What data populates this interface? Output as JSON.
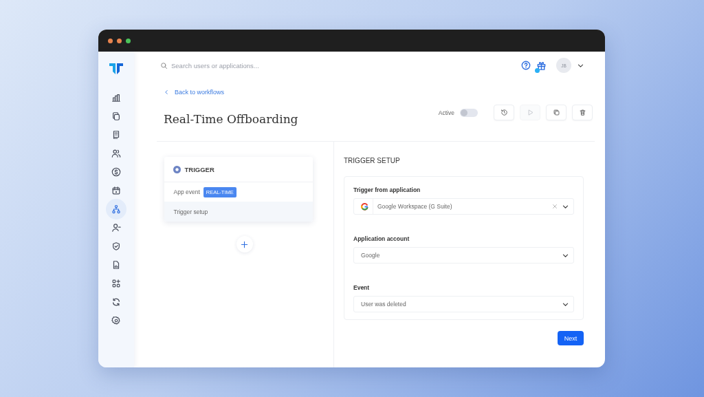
{
  "sidebar": {
    "items": [
      {
        "kind": "chart",
        "selected": false
      },
      {
        "kind": "copy",
        "selected": false
      },
      {
        "kind": "document",
        "selected": false
      },
      {
        "kind": "users",
        "selected": false
      },
      {
        "kind": "dollar",
        "selected": false
      },
      {
        "kind": "calendar",
        "selected": false
      },
      {
        "kind": "workflow",
        "selected": true
      },
      {
        "kind": "user-minus",
        "selected": false
      },
      {
        "kind": "shield",
        "selected": false
      },
      {
        "kind": "report",
        "selected": false
      },
      {
        "kind": "apps",
        "selected": false
      },
      {
        "kind": "sync",
        "selected": false
      },
      {
        "kind": "gear",
        "selected": false
      }
    ]
  },
  "search": {
    "placeholder": "Search users or applications..."
  },
  "header": {
    "avatar": "JB"
  },
  "back_link": "Back to workflows",
  "title": "Real-Time Offboarding",
  "active_toggle": {
    "label": "Active",
    "on": false
  },
  "toolbar": [
    {
      "kind": "history",
      "disabled": false
    },
    {
      "kind": "play",
      "disabled": true
    },
    {
      "kind": "copy",
      "disabled": false
    },
    {
      "kind": "delete",
      "disabled": false
    }
  ],
  "trigger_card": {
    "title": "TRIGGER",
    "rows": [
      {
        "label": "App event",
        "badge": "REAL-TIME",
        "selected": false
      },
      {
        "label": "Trigger setup",
        "selected": true
      }
    ]
  },
  "setup": {
    "title": "TRIGGER SETUP",
    "fields": [
      {
        "label": "Trigger from application",
        "value": "Google Workspace (G Suite)",
        "kind": "app"
      },
      {
        "label": "Application account",
        "value": "Google",
        "kind": "plain"
      },
      {
        "label": "Event",
        "value": "User was deleted",
        "kind": "plain"
      }
    ]
  },
  "next_button": "Next"
}
